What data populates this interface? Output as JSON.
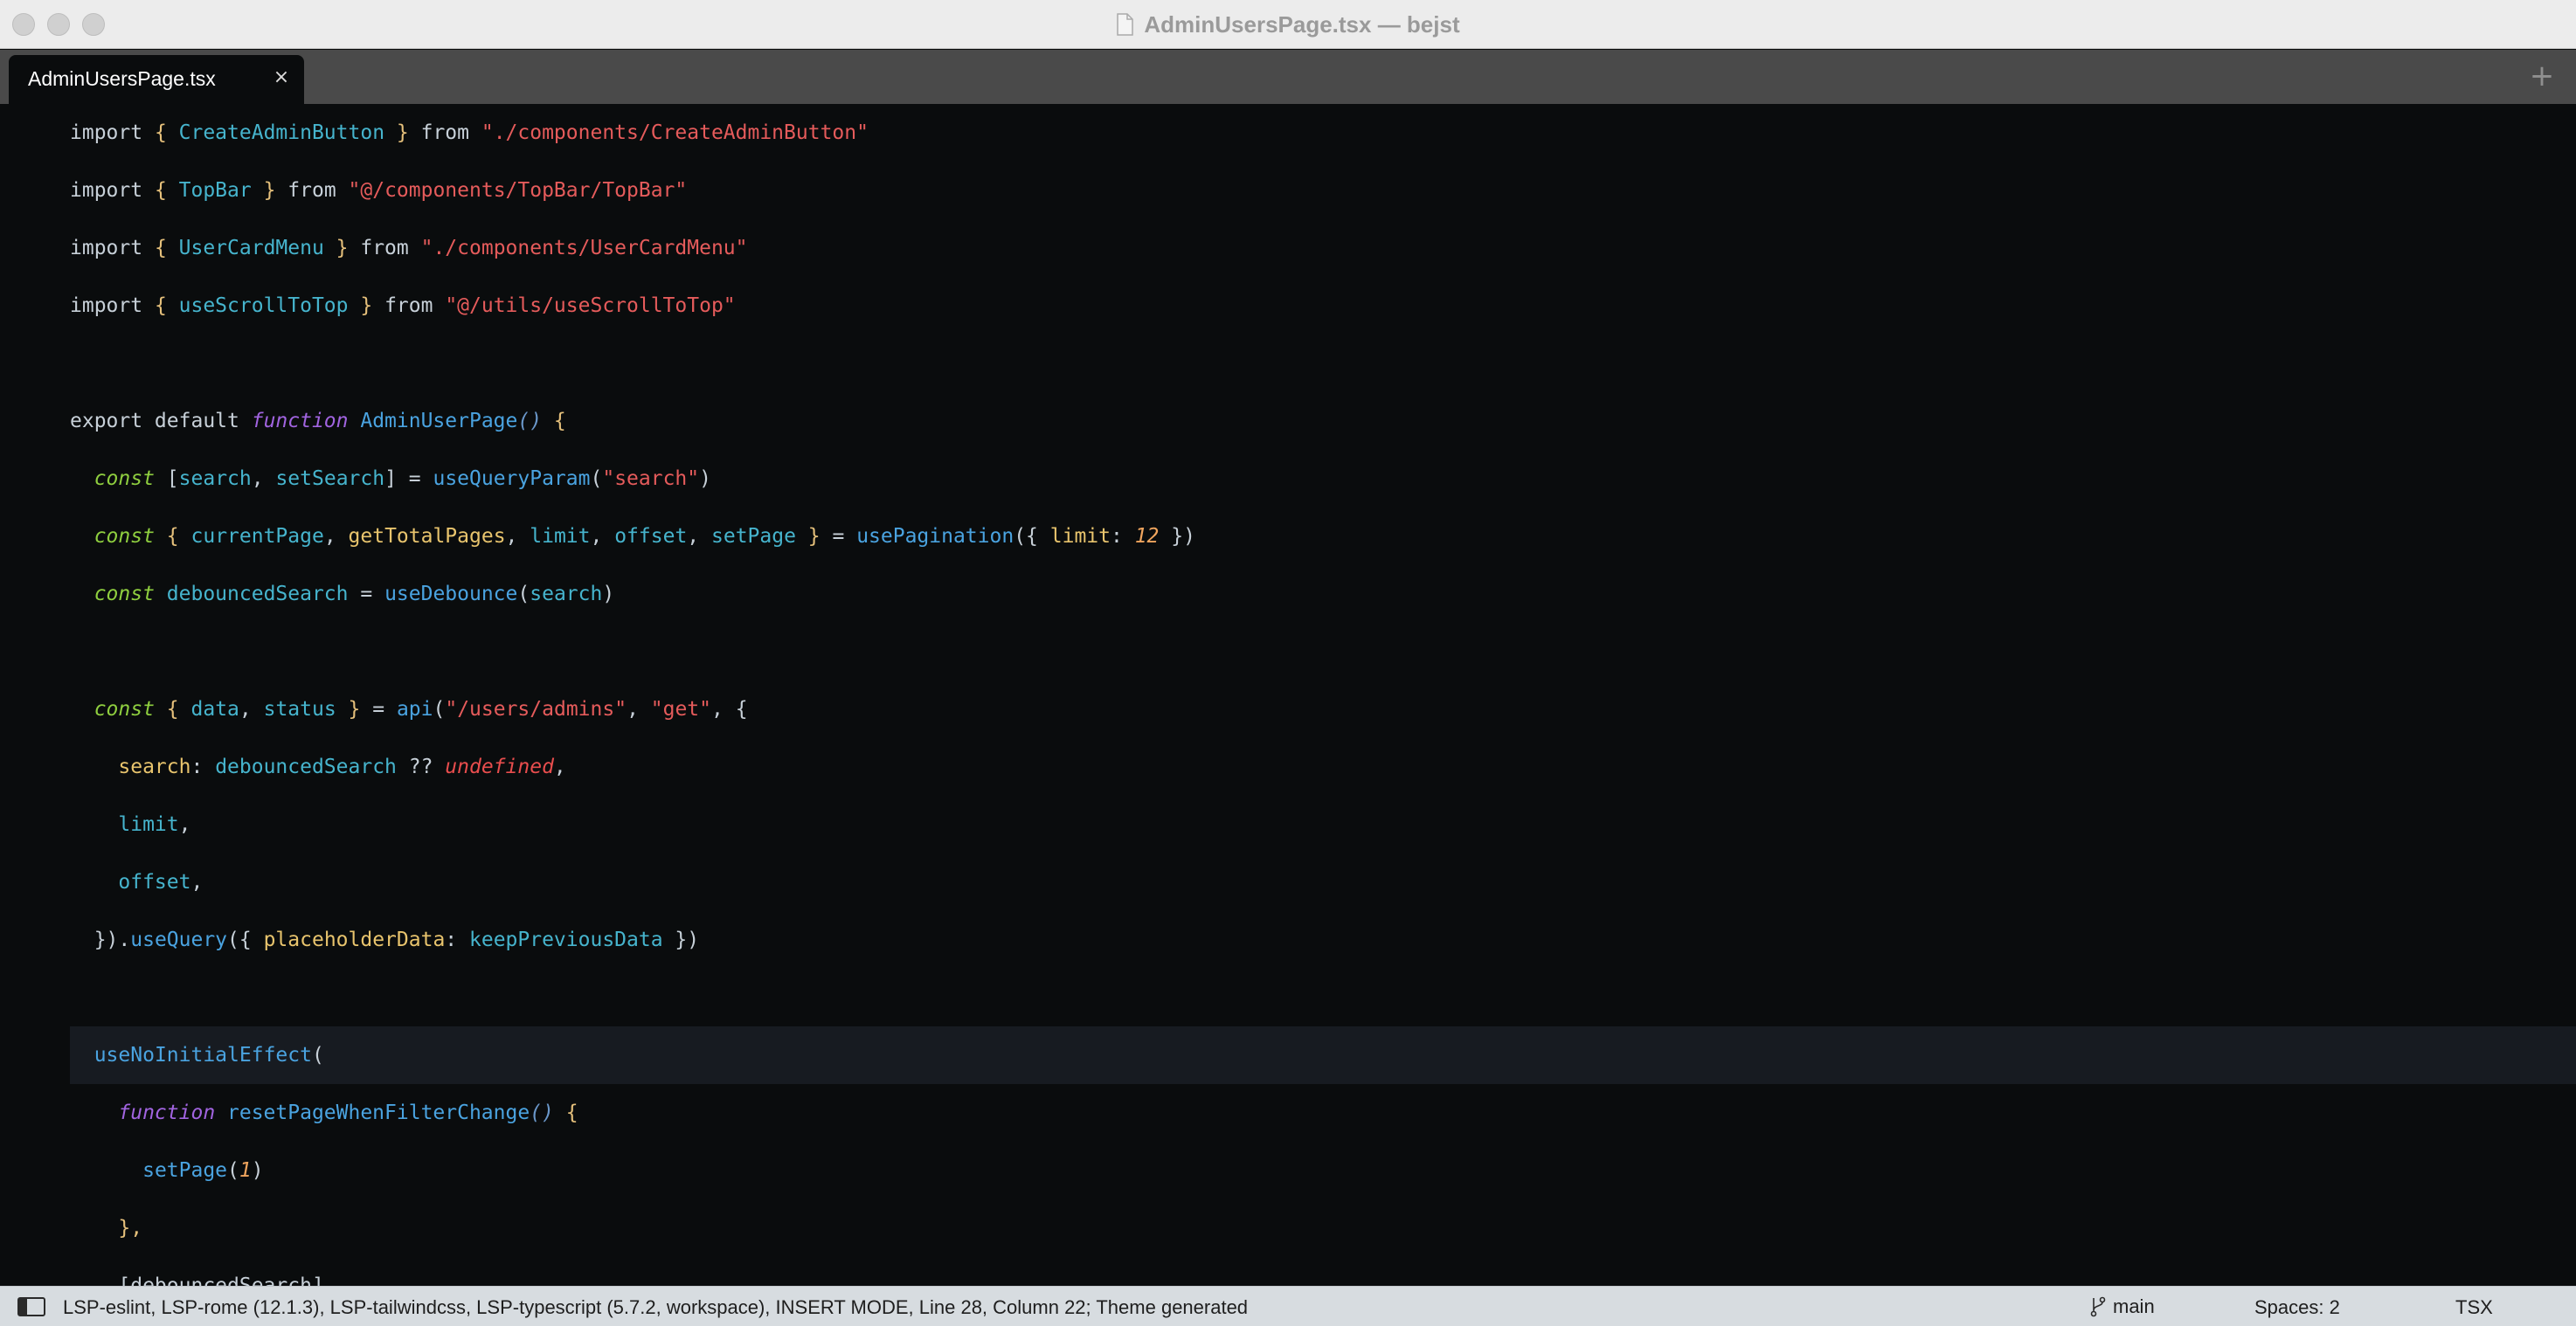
{
  "window": {
    "title": "AdminUsersPage.tsx — bejst"
  },
  "tabs": {
    "items": [
      {
        "label": "AdminUsersPage.tsx",
        "active": true
      }
    ],
    "close_glyph": "×",
    "new_tab_glyph": "+"
  },
  "colors": {
    "titlebar_bg": "#ececec",
    "tabbar_bg": "#4a4a4a",
    "editor_bg": "#0a0c0d",
    "current_line_bg": "#171b21",
    "statusbar_bg": "#d7dce0",
    "token": {
      "plain": "#c7d0d8",
      "keyword": "#c7d0d8",
      "brace": "#e5c07b",
      "func": "#4aa3e0",
      "name": "#46b4cd",
      "string": "#e55b5b",
      "storage": "#8fcf3f",
      "prop": "#e8c46d",
      "number": "#f0a55e",
      "undefined": "#e84d4d",
      "italic_func": "#a164e0",
      "paren": "#6a97c9"
    }
  },
  "editor": {
    "current_line_index": 16,
    "lines": [
      [
        [
          "keyword",
          "import "
        ],
        [
          "brace",
          "{ "
        ],
        [
          "name",
          "CreateAdminButton"
        ],
        [
          "brace",
          " }"
        ],
        [
          "keyword",
          " from "
        ],
        [
          "string",
          "\"./components/CreateAdminButton\""
        ]
      ],
      [
        [
          "keyword",
          "import "
        ],
        [
          "brace",
          "{ "
        ],
        [
          "name",
          "TopBar"
        ],
        [
          "brace",
          " }"
        ],
        [
          "keyword",
          " from "
        ],
        [
          "string",
          "\"@/components/TopBar/TopBar\""
        ]
      ],
      [
        [
          "keyword",
          "import "
        ],
        [
          "brace",
          "{ "
        ],
        [
          "name",
          "UserCardMenu"
        ],
        [
          "brace",
          " }"
        ],
        [
          "keyword",
          " from "
        ],
        [
          "string",
          "\"./components/UserCardMenu\""
        ]
      ],
      [
        [
          "keyword",
          "import "
        ],
        [
          "brace",
          "{ "
        ],
        [
          "name",
          "useScrollToTop"
        ],
        [
          "brace",
          " }"
        ],
        [
          "keyword",
          " from "
        ],
        [
          "string",
          "\"@/utils/useScrollToTop\""
        ]
      ],
      [],
      [
        [
          "keyword",
          "export default "
        ],
        [
          "italic_func",
          "function "
        ],
        [
          "func",
          "AdminUserPage"
        ],
        [
          "paren",
          "() "
        ],
        [
          "brace",
          "{"
        ]
      ],
      [
        [
          "plain",
          "  "
        ],
        [
          "storage",
          "const "
        ],
        [
          "plain",
          "["
        ],
        [
          "name",
          "search"
        ],
        [
          "plain",
          ", "
        ],
        [
          "name",
          "setSearch"
        ],
        [
          "plain",
          "] = "
        ],
        [
          "func",
          "useQueryParam"
        ],
        [
          "plain",
          "("
        ],
        [
          "string",
          "\"search\""
        ],
        [
          "plain",
          ")"
        ]
      ],
      [
        [
          "plain",
          "  "
        ],
        [
          "storage",
          "const "
        ],
        [
          "brace",
          "{ "
        ],
        [
          "name",
          "currentPage"
        ],
        [
          "plain",
          ", "
        ],
        [
          "prop",
          "getTotalPages"
        ],
        [
          "plain",
          ", "
        ],
        [
          "name",
          "limit"
        ],
        [
          "plain",
          ", "
        ],
        [
          "name",
          "offset"
        ],
        [
          "plain",
          ", "
        ],
        [
          "name",
          "setPage"
        ],
        [
          "brace",
          " }"
        ],
        [
          "plain",
          " = "
        ],
        [
          "func",
          "usePagination"
        ],
        [
          "plain",
          "({ "
        ],
        [
          "prop",
          "limit"
        ],
        [
          "plain",
          ": "
        ],
        [
          "number",
          "12"
        ],
        [
          "plain",
          " })"
        ]
      ],
      [
        [
          "plain",
          "  "
        ],
        [
          "storage",
          "const "
        ],
        [
          "name",
          "debouncedSearch"
        ],
        [
          "plain",
          " = "
        ],
        [
          "func",
          "useDebounce"
        ],
        [
          "plain",
          "("
        ],
        [
          "name",
          "search"
        ],
        [
          "plain",
          ")"
        ]
      ],
      [],
      [
        [
          "plain",
          "  "
        ],
        [
          "storage",
          "const "
        ],
        [
          "brace",
          "{ "
        ],
        [
          "name",
          "data"
        ],
        [
          "plain",
          ", "
        ],
        [
          "name",
          "status"
        ],
        [
          "brace",
          " }"
        ],
        [
          "plain",
          " = "
        ],
        [
          "func",
          "api"
        ],
        [
          "plain",
          "("
        ],
        [
          "string",
          "\"/users/admins\""
        ],
        [
          "plain",
          ", "
        ],
        [
          "string",
          "\"get\""
        ],
        [
          "plain",
          ", {"
        ]
      ],
      [
        [
          "plain",
          "    "
        ],
        [
          "prop",
          "search"
        ],
        [
          "plain",
          ": "
        ],
        [
          "name",
          "debouncedSearch"
        ],
        [
          "plain",
          " ?? "
        ],
        [
          "undefined",
          "undefined"
        ],
        [
          "plain",
          ","
        ]
      ],
      [
        [
          "plain",
          "    "
        ],
        [
          "name",
          "limit"
        ],
        [
          "plain",
          ","
        ]
      ],
      [
        [
          "plain",
          "    "
        ],
        [
          "name",
          "offset"
        ],
        [
          "plain",
          ","
        ]
      ],
      [
        [
          "plain",
          "  })."
        ],
        [
          "func",
          "useQuery"
        ],
        [
          "plain",
          "({ "
        ],
        [
          "prop",
          "placeholderData"
        ],
        [
          "plain",
          ": "
        ],
        [
          "name",
          "keepPreviousData"
        ],
        [
          "plain",
          " })"
        ]
      ],
      [],
      [
        [
          "plain",
          "  "
        ],
        [
          "func",
          "useNoInitialEffect"
        ],
        [
          "plain",
          "("
        ]
      ],
      [
        [
          "plain",
          "    "
        ],
        [
          "italic_func",
          "function "
        ],
        [
          "func",
          "resetPageWhenFilterChange"
        ],
        [
          "paren",
          "() "
        ],
        [
          "brace",
          "{"
        ]
      ],
      [
        [
          "plain",
          "      "
        ],
        [
          "func",
          "setPage"
        ],
        [
          "plain",
          "("
        ],
        [
          "number",
          "1"
        ],
        [
          "plain",
          ")"
        ]
      ],
      [
        [
          "plain",
          "    "
        ],
        [
          "brace",
          "},"
        ]
      ],
      [
        [
          "plain",
          "    "
        ],
        [
          "plain",
          "[debouncedSearch]"
        ]
      ]
    ]
  },
  "status": {
    "text": "LSP-eslint, LSP-rome (12.1.3), LSP-tailwindcss, LSP-typescript (5.7.2, workspace), INSERT MODE, Line 28, Column 22; Theme generated",
    "branch": "main",
    "spaces": "Spaces: 2",
    "syntax": "TSX"
  }
}
